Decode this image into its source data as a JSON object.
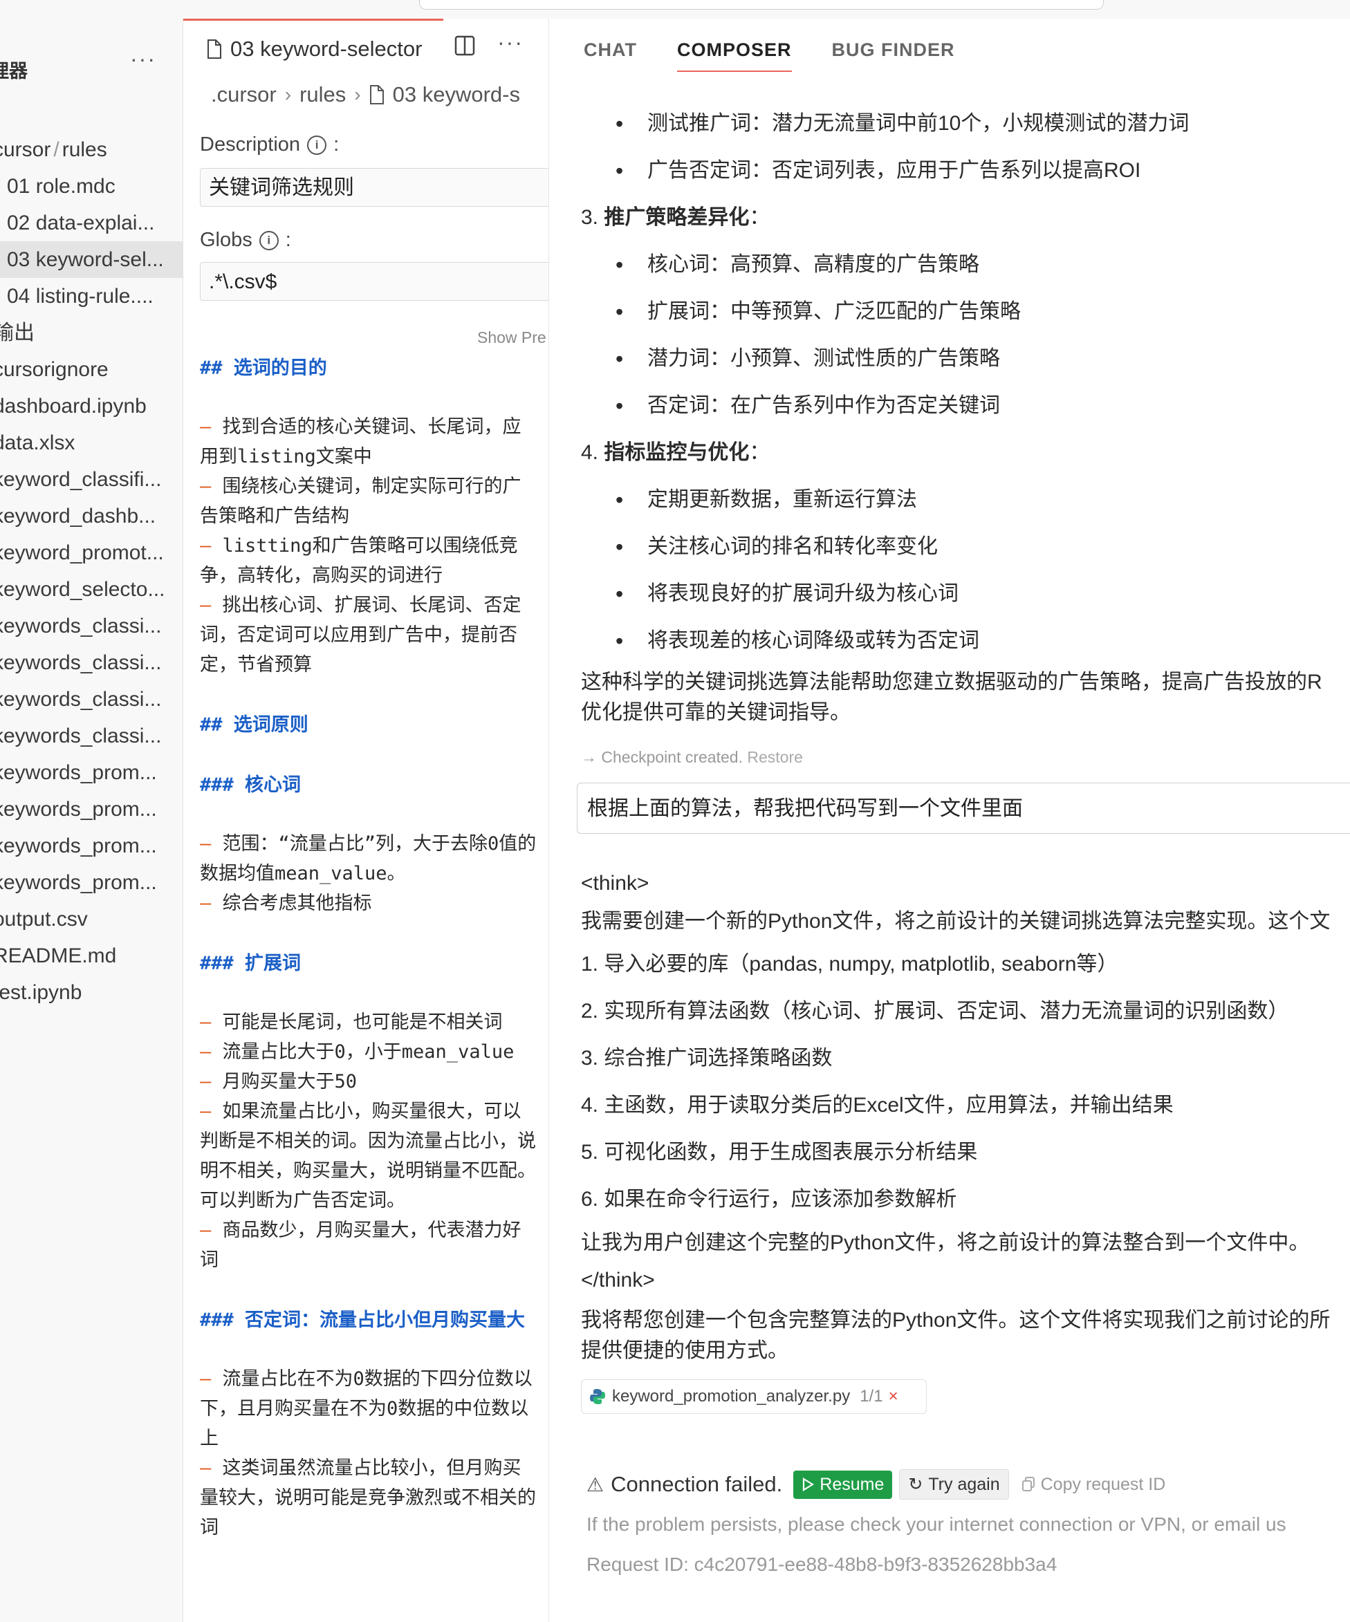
{
  "sidebar": {
    "title": "理器",
    "items": [
      {
        "label_a": "cursor",
        "label_b": "rules",
        "sep": "/"
      },
      {
        "label": "01 role.mdc"
      },
      {
        "label": "02 data-explai..."
      },
      {
        "label": "03 keyword-sel..."
      },
      {
        "label": "04 listing-rule...."
      },
      {
        "label": "输出"
      },
      {
        "label": "cursorignore"
      },
      {
        "label": "dashboard.ipynb"
      },
      {
        "label": "data.xlsx"
      },
      {
        "label": "keyword_classifi..."
      },
      {
        "label": "keyword_dashb..."
      },
      {
        "label": "keyword_promot..."
      },
      {
        "label": "keyword_selecto..."
      },
      {
        "label": "keywords_classi..."
      },
      {
        "label": "keywords_classi..."
      },
      {
        "label": "keywords_classi..."
      },
      {
        "label": "keywords_classi..."
      },
      {
        "label": "keywords_prom..."
      },
      {
        "label": "keywords_prom..."
      },
      {
        "label": "keywords_prom..."
      },
      {
        "label": "keywords_prom..."
      },
      {
        "label": "output.csv"
      },
      {
        "label": "README.md"
      },
      {
        "label": "test.ipynb"
      }
    ]
  },
  "editor": {
    "tab_label": "03 keyword-selector",
    "breadcrumb": [
      ".cursor",
      "rules",
      "03 keyword-s"
    ],
    "description_label": "Description",
    "description_value": "关键词筛选规则",
    "globs_label": "Globs",
    "globs_value": ".*\\.csv$",
    "show_preview": "Show Pre",
    "body": {
      "h1": "##  选词的目的",
      "p1": [
        "找到合适的核心关键词、长尾词，应",
        "用到listing文案中"
      ],
      "p2": [
        "围绕核心关键词，制定实际可行的广",
        "告策略和广告结构"
      ],
      "p3": [
        "listting和广告策略可以围绕低竞",
        "争，高转化，高购买的词进行"
      ],
      "p4": [
        "挑出核心词、扩展词、长尾词、否定",
        "词，否定词可以应用到广告中，提前否",
        "定，节省预算"
      ],
      "h2": "##  选词原则",
      "h3": "###  核心词",
      "c1": [
        "范围：“流量占比”列，大于去除0值的",
        "数据均值mean_value。"
      ],
      "c2": "综合考虑其他指标",
      "h4": "###  扩展词",
      "e1": "可能是长尾词，也可能是不相关词",
      "e2": "流量占比大于0，小于mean_value",
      "e3": "月购买量大于50",
      "e4": [
        "如果流量占比小，购买量很大，可以",
        "判断是不相关的词。因为流量占比小，说",
        "明不相关，购买量大，说明销量不匹配。",
        "可以判断为广告否定词。"
      ],
      "e5": [
        "商品数少，月购买量大，代表潜力好",
        "词"
      ],
      "h5": "###  否定词：流量占比小但月购买量大",
      "n1": [
        "流量占比在不为0数据的下四分位数以",
        "下，且月购买量在不为0数据的中位数以",
        "上"
      ],
      "n2": [
        "这类词虽然流量占比较小，但月购买",
        "量较大，说明可能是竞争激烈或不相关的",
        "词"
      ],
      "dash": "–"
    }
  },
  "chat": {
    "tabs": [
      "CHAT",
      "COMPOSER",
      "BUG FINDER"
    ],
    "bullets_a": [
      "测试推广词：潜力无流量词中前10个，小规模测试的潜力词",
      "广告否定词：否定词列表，应用于广告系列以提高ROI"
    ],
    "sec3_num": "3.",
    "sec3_title": "推广策略差异化",
    "colon": "：",
    "bullets_b": [
      "核心词：高预算、高精度的广告策略",
      "扩展词：中等预算、广泛匹配的广告策略",
      "潜力词：小预算、测试性质的广告策略",
      "否定词：在广告系列中作为否定关键词"
    ],
    "sec4_num": "4.",
    "sec4_title": "指标监控与优化",
    "bullets_c": [
      "定期更新数据，重新运行算法",
      "关注核心词的排名和转化率变化",
      "将表现良好的扩展词升级为核心词",
      "将表现差的核心词降级或转为否定词"
    ],
    "summary": [
      "这种科学的关键词挑选算法能帮助您建立数据驱动的广告策略，提高广告投放的R",
      "优化提供可靠的关键词指导。"
    ],
    "checkpoint": "Checkpoint created.",
    "restore": "Restore",
    "user_message": "根据上面的算法，帮我把代码写到一个文件里面",
    "think_open": "<think>",
    "think_intro": "我需要创建一个新的Python文件，将之前设计的关键词挑选算法完整实现。这个文",
    "think_steps": [
      "1. 导入必要的库（pandas, numpy, matplotlib, seaborn等）",
      "2. 实现所有算法函数（核心词、扩展词、否定词、潜力无流量词的识别函数）",
      "3. 综合推广词选择策略函数",
      "4. 主函数，用于读取分类后的Excel文件，应用算法，并输出结果",
      "5. 可视化函数，用于生成图表展示分析结果",
      "6. 如果在命令行运行，应该添加参数解析"
    ],
    "think_outro": "让我为用户创建这个完整的Python文件，将之前设计的算法整合到一个文件中。",
    "think_close": "</think>",
    "reply": [
      "我将帮您创建一个包含完整算法的Python文件。这个文件将实现我们之前讨论的所",
      "提供便捷的使用方式。"
    ],
    "file_chip": {
      "name": "keyword_promotion_analyzer.py",
      "count": "1/1",
      "close": "×"
    },
    "error": {
      "message": "Connection failed.",
      "resume": "Resume",
      "try_again": "Try again",
      "copy": "Copy request ID",
      "help": "If the problem persists, please check your internet connection or VPN, or email us",
      "request_id": "Request ID: c4c20791-ee88-48b8-b9f3-8352628bb3a4"
    }
  }
}
